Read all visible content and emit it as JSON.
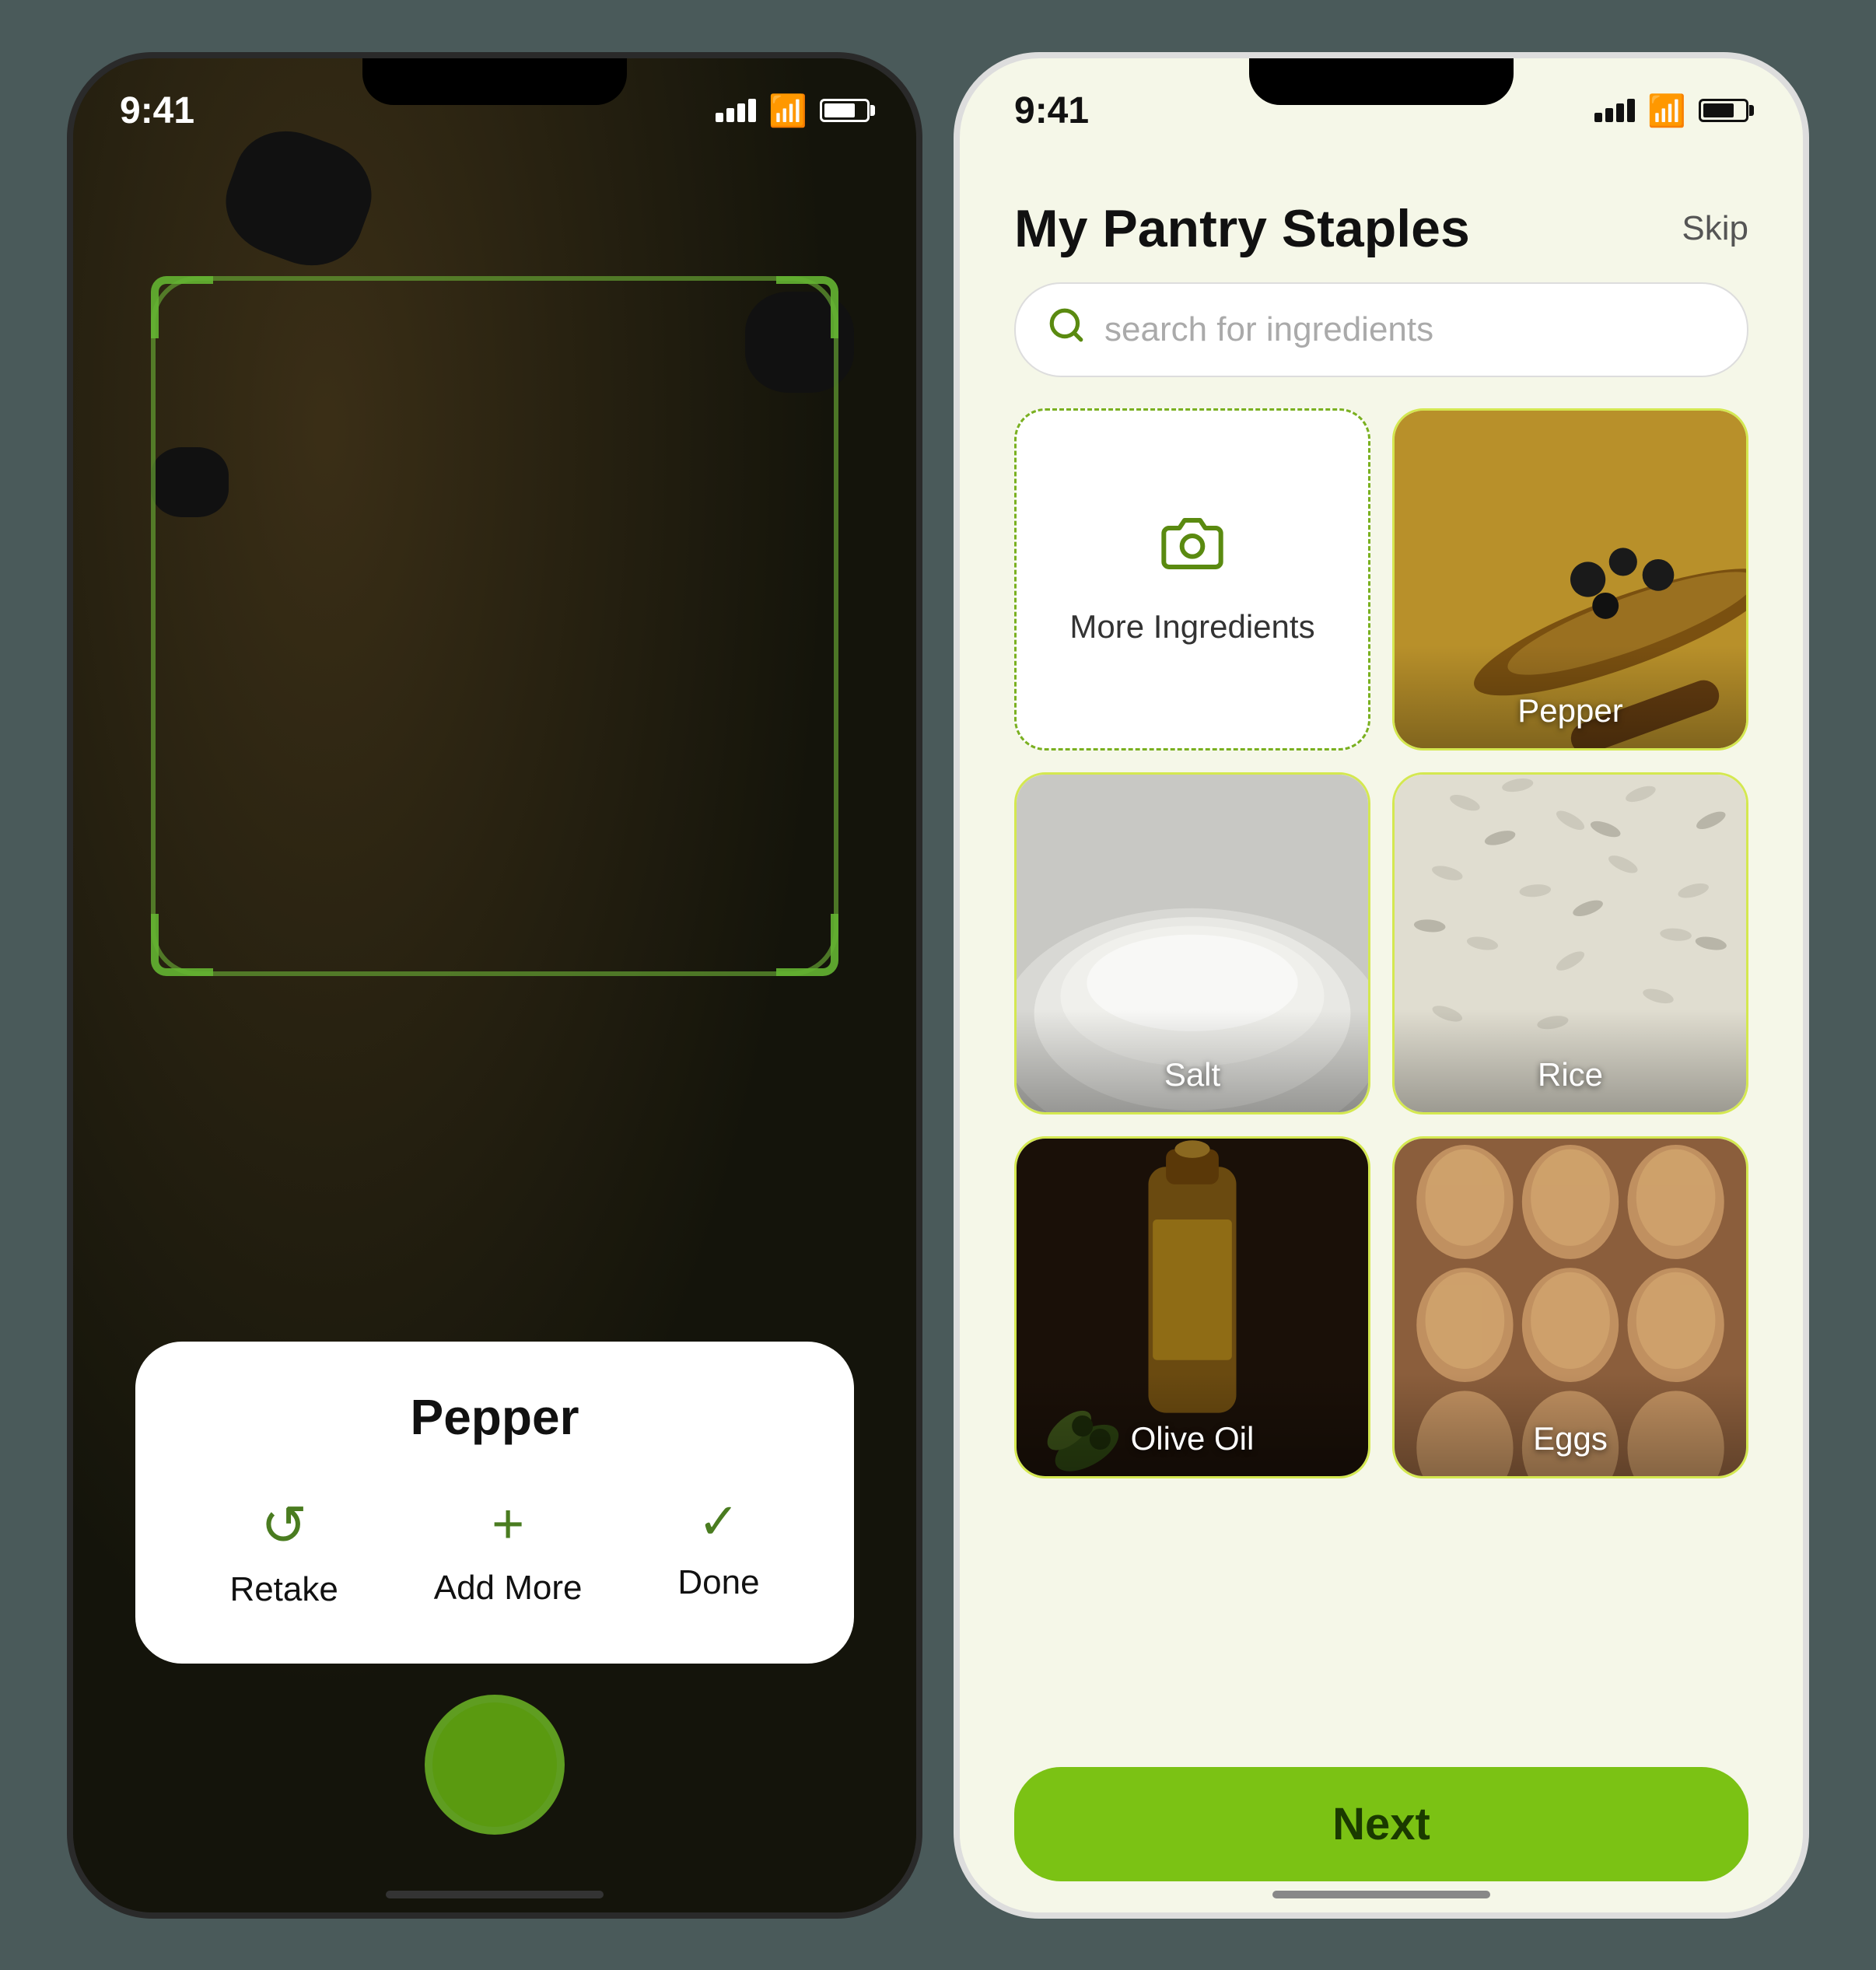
{
  "left_phone": {
    "time": "9:41",
    "card": {
      "title": "Pepper",
      "actions": [
        {
          "label": "Retake",
          "icon": "↺"
        },
        {
          "label": "Add More",
          "icon": "+"
        },
        {
          "label": "Done",
          "icon": "✓"
        }
      ]
    }
  },
  "right_phone": {
    "time": "9:41",
    "header": {
      "title": "My Pantry Staples",
      "skip": "Skip"
    },
    "search": {
      "placeholder": "search for ingredients"
    },
    "ingredients": [
      {
        "id": "more",
        "label": "More Ingredients",
        "type": "add"
      },
      {
        "id": "pepper",
        "label": "Pepper",
        "type": "image",
        "img_class": "img-pepper"
      },
      {
        "id": "salt",
        "label": "Salt",
        "type": "image",
        "img_class": "img-salt",
        "light": true
      },
      {
        "id": "rice",
        "label": "Rice",
        "type": "image",
        "img_class": "img-rice",
        "light": true
      },
      {
        "id": "olive_oil",
        "label": "Olive Oil",
        "type": "image",
        "img_class": "img-olive"
      },
      {
        "id": "eggs",
        "label": "Eggs",
        "type": "image",
        "img_class": "img-eggs"
      }
    ],
    "next_button": "Next"
  }
}
